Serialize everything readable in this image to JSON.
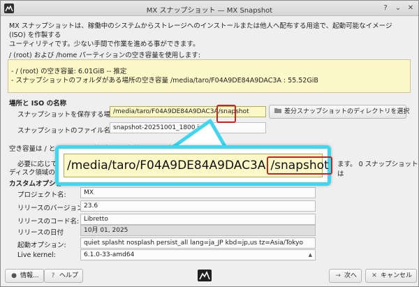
{
  "window": {
    "title": "MX スナップショット — MX Snapshot",
    "help_glyph": "?",
    "minimize_glyph": "⌄",
    "close_glyph": "✕"
  },
  "intro": {
    "line1": "MX スナップショットは、稼働中のシステムからストレージへのインストールまたは他人へ配布する用途で、起動可能なイメージ (ISO) を作製する",
    "line2": "ユーティリティです。少ない手間で作業を進める事ができます。"
  },
  "disk_usage": {
    "hint": "/ (root) および /home パーティションの空き容量を使用します:",
    "root_free": "- / (root) の空き容量: 6.01GiB -- 推定",
    "folder_free": "- スナップショットのフォルダがある場所の空き容量 /media/taro/F04A9DE84A9DAC3A : 55.52GiB"
  },
  "location_section": {
    "title": "場所と ISO の名称",
    "save_label": "スナップショットを保存する場所:",
    "save_path": "/media/taro/F04A9DE84A9DAC3A/snapshot",
    "select_dir_button": "差分スナップショットのディレクトリを選択",
    "filename_label": "スナップショットのファイル名:",
    "filename": "snapshot-20251001_1800.iso"
  },
  "notes": {
    "space_note": "空き容量は / と /home の圧縮データを保持するのに十分な必要があります。",
    "caution_start": "必要に応じて、",
    "caution_end": "ます。 0 スナップショットは",
    "caution_line2": "ディスク領域の 0MB"
  },
  "custom_section": {
    "title": "カスタムオプション",
    "fields": {
      "project_name": {
        "label": "プロジェクト名:",
        "value": "MX"
      },
      "release_version": {
        "label": "リリースのバージョン:",
        "value": "23.6"
      },
      "release_codename": {
        "label": "リリースのコード名:",
        "value": "Libretto"
      },
      "release_date": {
        "label": "リリースの日付",
        "value": "10月 01, 2025"
      },
      "boot_options": {
        "label": "起動オプション:",
        "value": "quiet splasht nosplash persist_all lang=ja_JP kbd=jp,us tz=Asia/Tokyo"
      },
      "live_kernel": {
        "label": "Live kernel:",
        "value": "6.1.0-33-amd64"
      }
    }
  },
  "footer": {
    "info_button": "情報...",
    "help_button": "ヘルプ",
    "next_button": "次へ",
    "cancel_button": "キャンセル"
  },
  "callout": {
    "path_prefix": "/media/taro/F04A9DE84A9DAC3A",
    "path_highlight": "/snapshot"
  },
  "colors": {
    "callout_border": "#3fd6f0",
    "highlight_red": "#d02020",
    "edit_field_bg": "#fcf8c8"
  }
}
